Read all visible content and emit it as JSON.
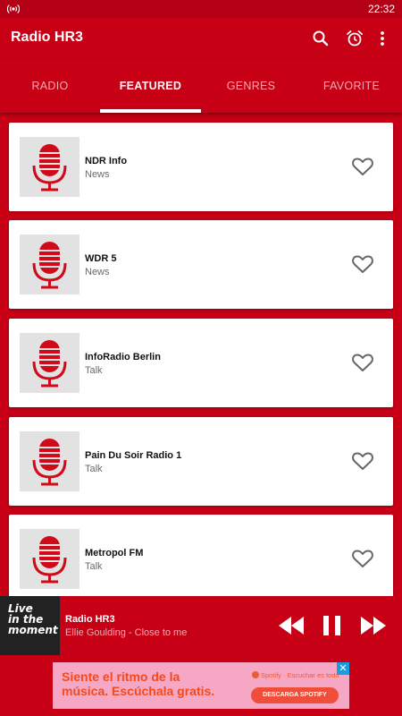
{
  "status_bar": {
    "time": "22:32",
    "icon": "radio-broadcast-icon"
  },
  "app_bar": {
    "title": "Radio HR3",
    "actions": [
      "search-icon",
      "alarm-icon",
      "more-vert-icon"
    ]
  },
  "tabs": [
    {
      "label": "RADIO",
      "active": false
    },
    {
      "label": "FEATURED",
      "active": true
    },
    {
      "label": "GENRES",
      "active": false
    },
    {
      "label": "FAVORITE",
      "active": false
    }
  ],
  "stations": [
    {
      "name": "NDR Info",
      "genre": "News"
    },
    {
      "name": "WDR 5",
      "genre": "News"
    },
    {
      "name": "InfoRadio Berlin",
      "genre": "Talk"
    },
    {
      "name": "Pain Du Soir Radio 1",
      "genre": "Talk"
    },
    {
      "name": "Metropol FM",
      "genre": "Talk"
    }
  ],
  "player": {
    "cover_text": [
      "Live",
      "in the",
      "moment"
    ],
    "station": "Radio HR3",
    "track": "Ellie Goulding - Close to me",
    "controls": [
      "rewind-icon",
      "pause-icon",
      "fast-forward-icon"
    ]
  },
  "ad": {
    "headline": "Siente el ritmo de la música. Escúchala gratis.",
    "brand": "Spotify · Escuchar es todo",
    "cta": "DESCARGA SPOTIFY",
    "close": "✕"
  },
  "colors": {
    "primary": "#c70016",
    "status_bar": "#b40014",
    "accent_tab_inactive": "#f3aab2",
    "ad_bg": "#f6a7c3"
  }
}
